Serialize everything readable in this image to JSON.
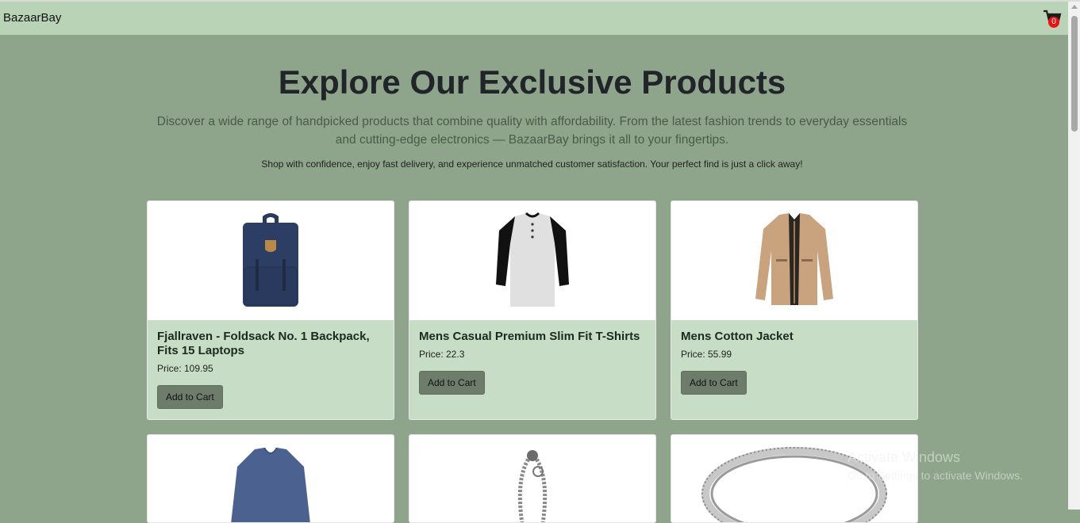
{
  "navbar": {
    "brand": "BazaarBay",
    "cart_count": "0",
    "cart_icon": "cart-icon"
  },
  "hero": {
    "title": "Explore Our Exclusive Products",
    "subtitle": "Discover a wide range of handpicked products that combine quality with affordability. From the latest fashion trends to everyday essentials and cutting-edge electronics — BazaarBay brings it all to your fingertips.",
    "tagline": "Shop with confidence, enjoy fast delivery, and experience unmatched customer satisfaction. Your perfect find is just a click away!"
  },
  "products": [
    {
      "title": "Fjallraven - Foldsack No. 1 Backpack, Fits 15 Laptops",
      "price": "Price: 109.95",
      "button": "Add to Cart",
      "image": "backpack-image"
    },
    {
      "title": "Mens Casual Premium Slim Fit T-Shirts",
      "price": "Price: 22.3",
      "button": "Add to Cart",
      "image": "tshirt-image"
    },
    {
      "title": "Mens Cotton Jacket",
      "price": "Price: 55.99",
      "button": "Add to Cart",
      "image": "jacket-image"
    },
    {
      "image": "sweater-image"
    },
    {
      "image": "bracelet-image"
    },
    {
      "image": "ring-image"
    }
  ],
  "watermark": {
    "line1": "Activate Windows",
    "line2": "Go to Settings to activate Windows."
  }
}
